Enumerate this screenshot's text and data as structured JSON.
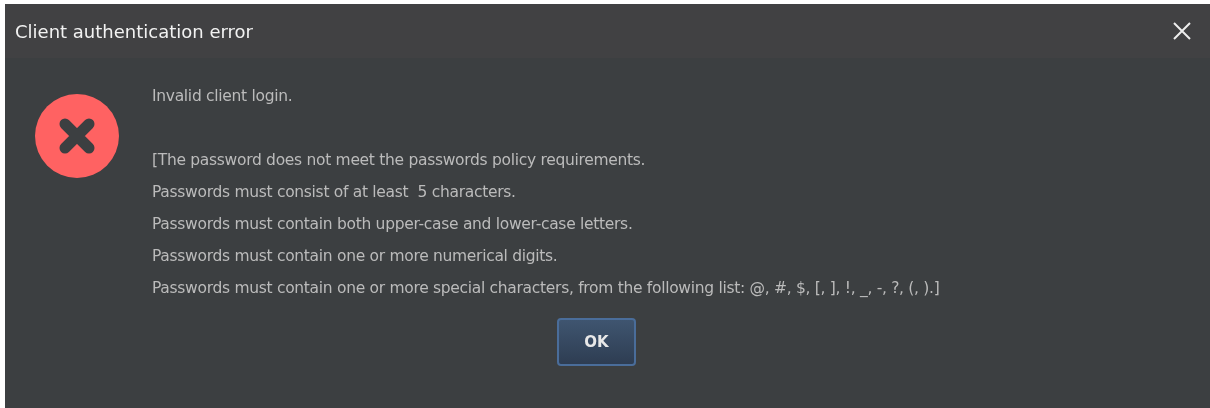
{
  "window": {
    "title": "Client authentication error"
  },
  "message": {
    "summary": "Invalid client login.",
    "details": [
      "[The password does not meet the passwords policy requirements.",
      "Passwords must consist of at least  5 characters.",
      "Passwords must contain both upper-case and lower-case letters.",
      "Passwords must contain one or more numerical digits.",
      "Passwords must contain one or more special characters, from the following list: @, #, $, [, ], !, _, -, ?, (, ).]"
    ]
  },
  "buttons": [
    {
      "label": "OK",
      "default": true
    }
  ]
}
